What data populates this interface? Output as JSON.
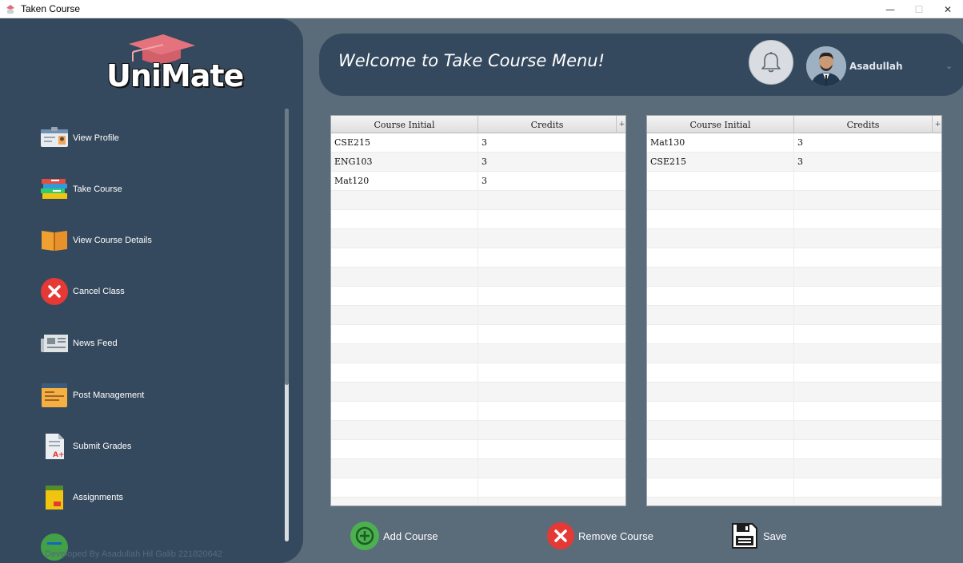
{
  "window": {
    "title": "Taken Course"
  },
  "logo": {
    "text": "UniMate"
  },
  "sidebar": {
    "items": [
      {
        "label": "View Profile",
        "icon": "id-card-icon"
      },
      {
        "label": "Take Course",
        "icon": "books-stack-icon"
      },
      {
        "label": "View Course Details",
        "icon": "open-book-icon"
      },
      {
        "label": "Cancel Class",
        "icon": "cancel-x-icon"
      },
      {
        "label": "News Feed",
        "icon": "newspaper-icon"
      },
      {
        "label": "Post Management",
        "icon": "post-board-icon"
      },
      {
        "label": "Submit Grades",
        "icon": "grade-sheet-icon"
      },
      {
        "label": "Assignments",
        "icon": "assignment-book-icon"
      }
    ],
    "credit": "Developed By Asadullah Hil Galib 221820642"
  },
  "header": {
    "welcome": "Welcome to Take Course Menu!",
    "username": "Asadullah"
  },
  "tables": {
    "available": {
      "columns": [
        "Course Initial",
        "Credits"
      ],
      "rows": [
        [
          "CSE215",
          "3"
        ],
        [
          "ENG103",
          "3"
        ],
        [
          "Mat120",
          "3"
        ]
      ]
    },
    "taken": {
      "columns": [
        "Course Initial",
        "Credits"
      ],
      "rows": [
        [
          "Mat130",
          "3"
        ],
        [
          "CSE215",
          "3"
        ]
      ]
    }
  },
  "actions": {
    "add": "Add Course",
    "remove": "Remove Course",
    "save": "Save"
  },
  "colors": {
    "panel": "#35495e",
    "background": "#5a6b7a",
    "add_green": "#4caf50",
    "remove_red": "#e53935"
  }
}
